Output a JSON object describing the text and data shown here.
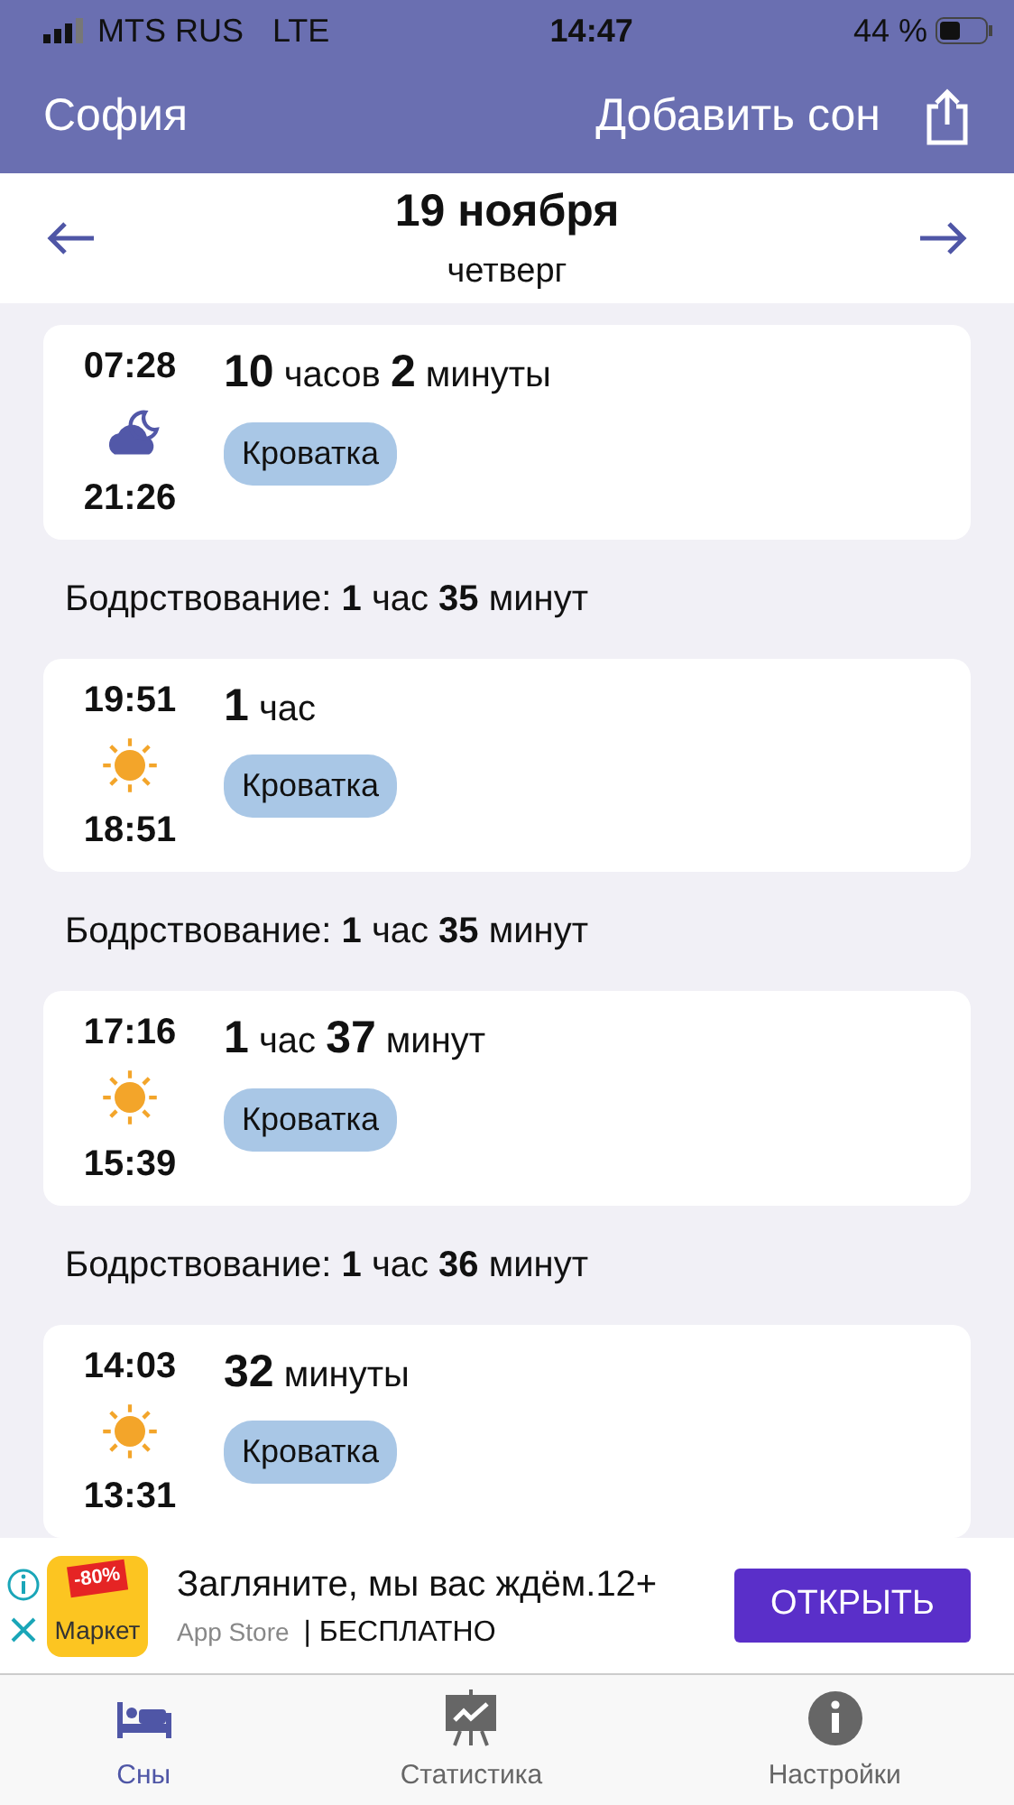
{
  "status_bar": {
    "carrier": "MTS RUS",
    "network": "LTE",
    "time": "14:47",
    "battery": "44 %"
  },
  "header": {
    "title": "София",
    "action": "Добавить сон"
  },
  "date": {
    "day": "19 ноября",
    "weekday": "четверг"
  },
  "entries": [
    {
      "kind": "night",
      "end": "07:28",
      "start": "21:26",
      "duration": "**10** часов **2** минуты",
      "tag": "Кроватка"
    },
    {
      "kind": "awake",
      "text": "Бодрствование: **1** час **35** минут"
    },
    {
      "kind": "day",
      "end": "19:51",
      "start": "18:51",
      "duration": "**1** час",
      "tag": "Кроватка"
    },
    {
      "kind": "awake",
      "text": "Бодрствование: **1** час **35** минут"
    },
    {
      "kind": "day",
      "end": "17:16",
      "start": "15:39",
      "duration": "**1** час **37** минут",
      "tag": "Кроватка"
    },
    {
      "kind": "awake",
      "text": "Бодрствование: **1** час **36** минут"
    },
    {
      "kind": "day",
      "end": "14:03",
      "start": "13:31",
      "duration": "**32** минуты",
      "tag": "Кроватка"
    }
  ],
  "ad": {
    "badge": "-80%",
    "logo": "Маркет",
    "title": "Загляните, мы вас ждём.12+",
    "store": "App Store",
    "price": "| БЕСПЛАТНО",
    "button": "ОТКРЫТЬ"
  },
  "tabs": [
    {
      "label": "Сны",
      "selected": true
    },
    {
      "label": "Статистика",
      "selected": false
    },
    {
      "label": "Настройки",
      "selected": false
    }
  ]
}
